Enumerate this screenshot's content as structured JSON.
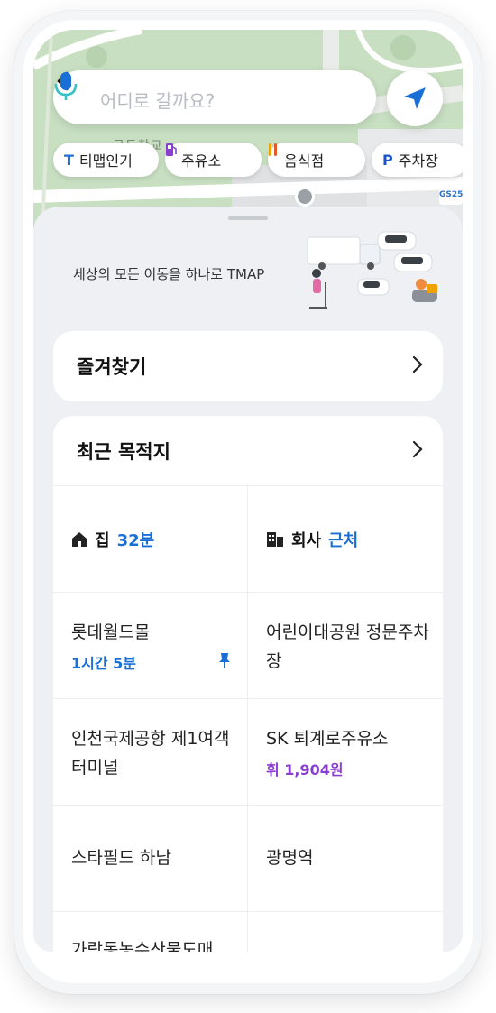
{
  "search": {
    "placeholder": "어디로 갈까요?"
  },
  "map": {
    "label": "근두창교",
    "gs_badge": "GS25"
  },
  "chips": [
    {
      "icon": "T",
      "label": "티맵인기",
      "color": "#1a6fd6"
    },
    {
      "icon": "⛽",
      "label": "주유소",
      "color": "#8a3fd1"
    },
    {
      "icon": "🍴",
      "label": "음식점",
      "color": "#f0a000"
    },
    {
      "icon": "P",
      "label": "주차장",
      "color": "#1a55c8"
    }
  ],
  "banner": {
    "text": "세상의 모든 이동을 하나로  TMAP"
  },
  "favorites": {
    "title": "즐겨찾기"
  },
  "recent": {
    "title": "최근 목적지",
    "home": {
      "label": "집",
      "time": "32분"
    },
    "office": {
      "label": "회사",
      "status": "근처"
    },
    "items": [
      {
        "title": "롯데월드몰",
        "sub": "1시간 5분",
        "sub_color": "blue",
        "pinned": true
      },
      {
        "title": "어린이대공원 정문주차장",
        "sub": "",
        "sub_color": ""
      },
      {
        "title": "인천국제공항 제1여객터미널",
        "sub": "",
        "sub_color": ""
      },
      {
        "title": "SK 퇴계로주유소",
        "sub": "휘 1,904원",
        "sub_color": "purple"
      },
      {
        "title": "스타필드 하남",
        "sub": "",
        "sub_color": ""
      },
      {
        "title": "광명역",
        "sub": "",
        "sub_color": ""
      },
      {
        "title": "가락동농수산물도매",
        "sub": "",
        "sub_color": ""
      }
    ]
  },
  "colors": {
    "accent_blue": "#1a6fd6",
    "accent_purple": "#8a3fd1",
    "background": "#eef0f3"
  }
}
